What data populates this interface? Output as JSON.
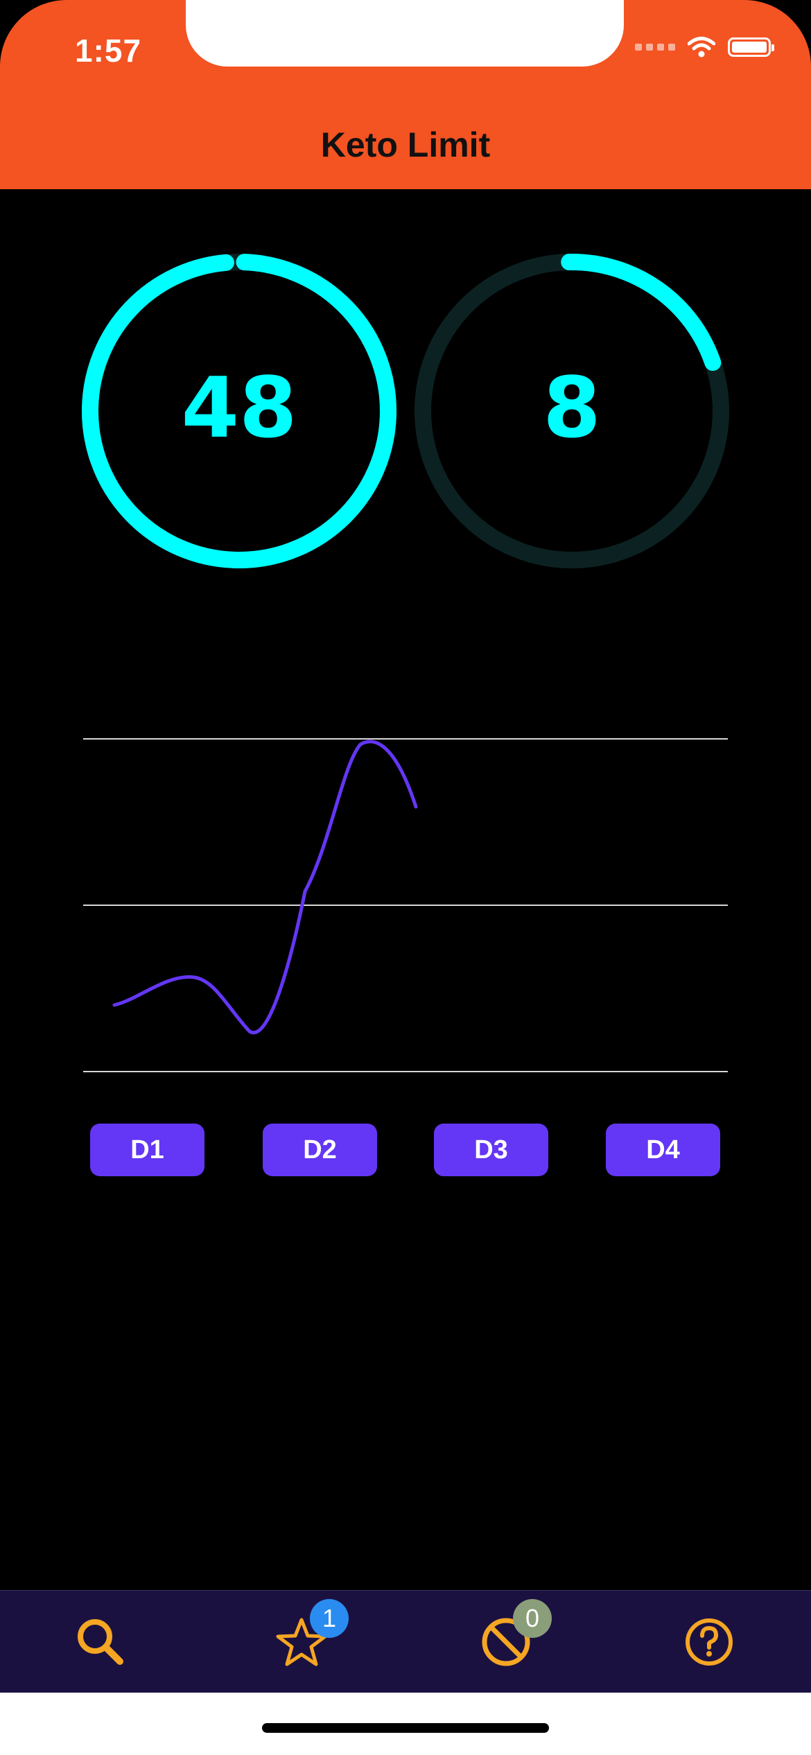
{
  "status_bar": {
    "time": "1:57"
  },
  "header": {
    "title": "Keto Limit",
    "color": "#F45322"
  },
  "rings": [
    {
      "value": "48",
      "progress": 0.98,
      "color": "#00FFFF"
    },
    {
      "value": "8",
      "progress": 0.2,
      "color": "#00FFFF"
    }
  ],
  "chart_data": {
    "type": "line",
    "categories": [
      "D1",
      "D2",
      "D3",
      "D4"
    ],
    "series": [
      {
        "values": [
          0.4,
          0.25,
          1.85
        ]
      }
    ],
    "color": "#6436F5",
    "grid": true
  },
  "day_buttons": [
    {
      "label": "D1"
    },
    {
      "label": "D2"
    },
    {
      "label": "D3"
    },
    {
      "label": "D4"
    }
  ],
  "tabbar": {
    "items": [
      {
        "icon": "search-icon"
      },
      {
        "icon": "star-icon",
        "badge": "1",
        "badge_color": "#2A8CF0"
      },
      {
        "icon": "block-icon",
        "badge": "0",
        "badge_color": "#8A9E7A"
      },
      {
        "icon": "help-icon"
      }
    ],
    "icon_color": "#F5A623"
  }
}
